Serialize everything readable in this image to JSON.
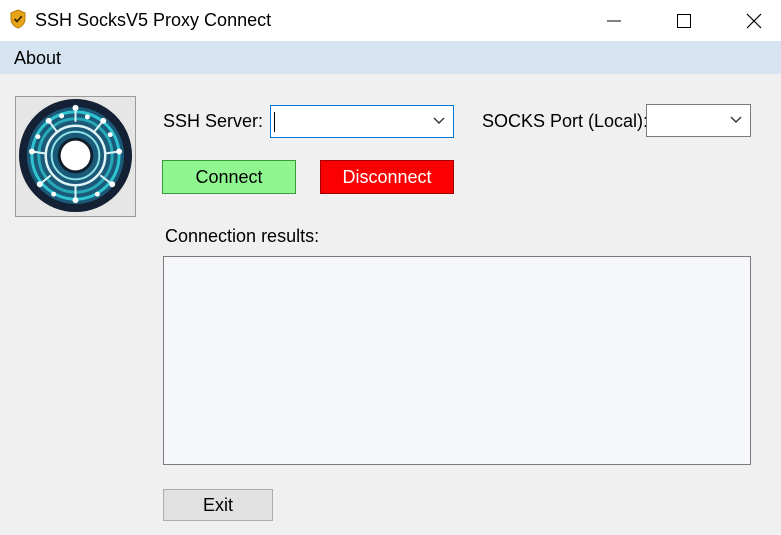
{
  "window": {
    "title": "SSH SocksV5 Proxy Connect",
    "icon": "shield-icon",
    "controls": [
      "minimize-icon",
      "maximize-icon",
      "close-icon"
    ]
  },
  "menu": {
    "about_label": "About"
  },
  "logo": {
    "icon": "circuit-spiral-logo-icon"
  },
  "form": {
    "ssh_server_label": "SSH Server:",
    "ssh_server_value": "",
    "socks_port_label": "SOCKS Port (Local):",
    "socks_port_value": ""
  },
  "buttons": {
    "connect_label": "Connect",
    "disconnect_label": "Disconnect",
    "exit_label": "Exit"
  },
  "results": {
    "label": "Connection results:",
    "text": ""
  },
  "colors": {
    "menubar": "#d6e4f2",
    "connect_bg": "#90f790",
    "disconnect_bg": "#fb0000",
    "focus_border": "#0078d7",
    "shield": "#e8a317"
  }
}
